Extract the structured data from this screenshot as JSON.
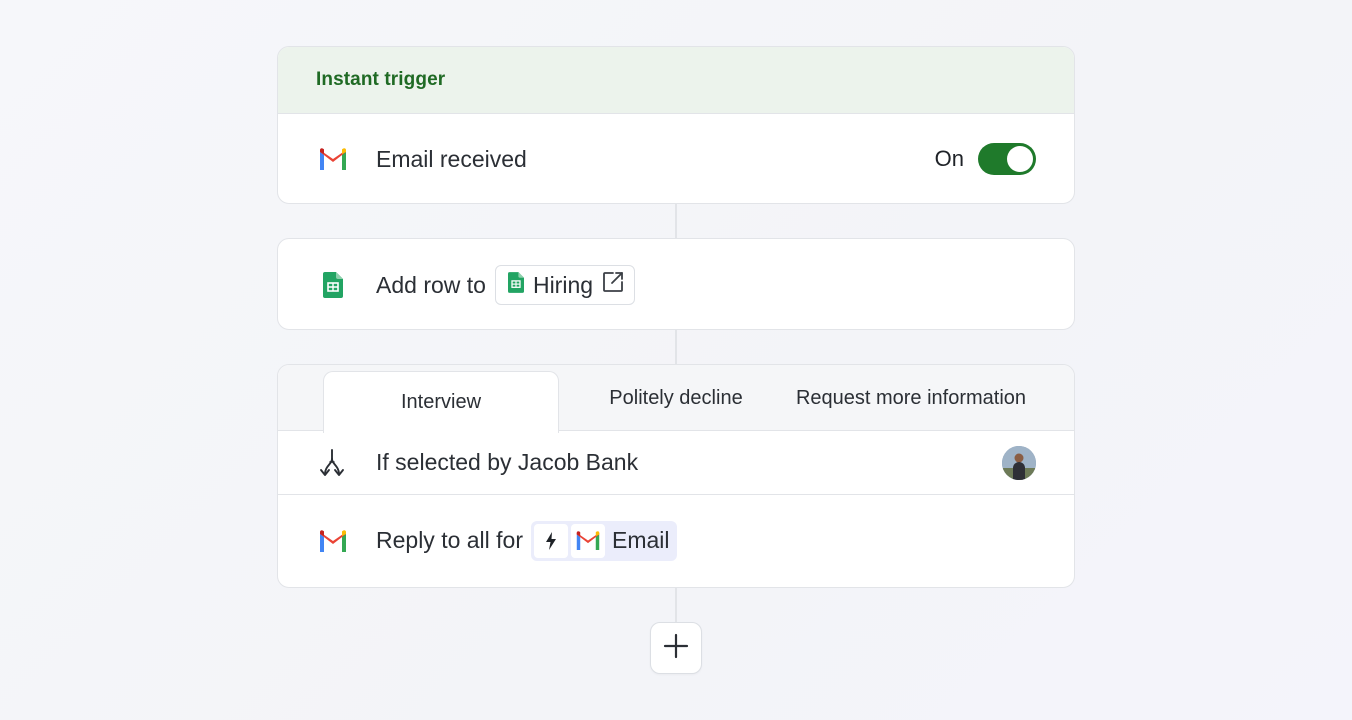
{
  "trigger": {
    "header": "Instant trigger",
    "app_icon": "gmail-icon",
    "label": "Email received",
    "toggle": {
      "label": "On",
      "state": true,
      "color": "#1f7a2b"
    }
  },
  "sheets_step": {
    "app_icon": "google-sheets-icon",
    "label": "Add row to",
    "chip": {
      "icon": "google-sheets-icon",
      "text": "Hiring",
      "action_icon": "external-link-icon"
    }
  },
  "branch_step": {
    "tabs": [
      {
        "label": "Interview",
        "active": true
      },
      {
        "label": "Politely decline",
        "active": false
      },
      {
        "label": "Request more information",
        "active": false
      }
    ],
    "condition": {
      "icon": "branch-icon",
      "label": "If selected by Jacob Bank",
      "avatar": "user-avatar"
    },
    "reply": {
      "app_icon": "gmail-icon",
      "label": "Reply to all for",
      "variable": {
        "trigger_icon": "bolt-icon",
        "app_icon": "gmail-icon",
        "text": "Email"
      }
    }
  },
  "add_step": {
    "icon": "plus-icon"
  },
  "colors": {
    "accent_green": "#1f7a2b",
    "header_green_text": "#1f6a24",
    "header_green_bg": "#ecf3ec",
    "variable_bg": "#ebedfb"
  }
}
